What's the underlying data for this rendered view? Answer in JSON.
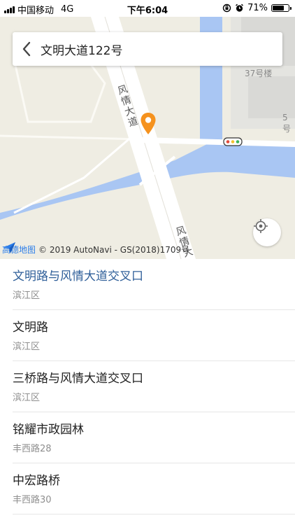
{
  "status_bar": {
    "carrier": "中国移动",
    "network": "4G",
    "time": "下午6:04",
    "battery_text": "71%",
    "battery_level": 0.71
  },
  "search": {
    "query": "文明大道122号"
  },
  "map": {
    "labels": {
      "building_37": "37号楼",
      "building_5": "5号",
      "road_fengqing_upper": "风情大道",
      "road_fengqing_lower": "风情大"
    },
    "attribution": {
      "brand": "高德地图",
      "copyright": "© 2019 AutoNavi - GS(2018)1709号"
    },
    "colors": {
      "land": "#efede3",
      "water": "#a9c6f3",
      "road": "#ffffff",
      "marker": "#f5921e"
    }
  },
  "results": [
    {
      "title": "文明路与风情大道交叉口",
      "subtitle": "滨江区",
      "active": true
    },
    {
      "title": "文明路",
      "subtitle": "滨江区",
      "active": false
    },
    {
      "title": "三桥路与风情大道交叉口",
      "subtitle": "滨江区",
      "active": false
    },
    {
      "title": "铭耀市政园林",
      "subtitle": "丰西路28",
      "active": false
    },
    {
      "title": "中宏路桥",
      "subtitle": "丰西路30",
      "active": false
    }
  ]
}
